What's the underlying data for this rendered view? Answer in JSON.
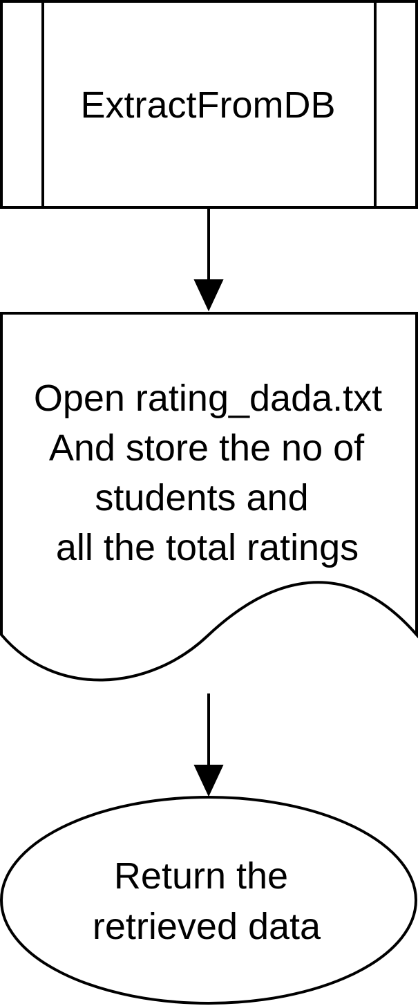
{
  "diagram": {
    "subprocess": {
      "label": "ExtractFromDB"
    },
    "document": {
      "lines": [
        "Open rating_dada.txt",
        "And store the no of",
        "students and",
        "all the total ratings"
      ]
    },
    "terminator": {
      "lines": [
        "Return the",
        "retrieved data"
      ]
    }
  }
}
